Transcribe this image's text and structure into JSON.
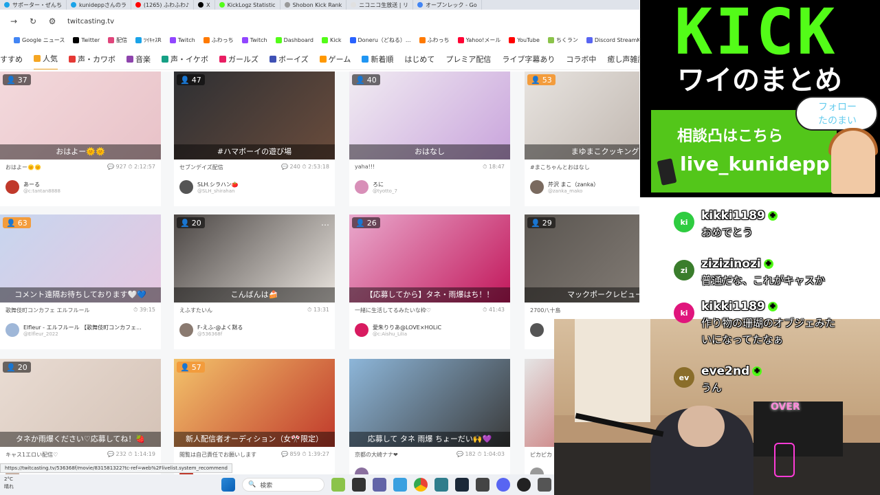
{
  "tabs": [
    {
      "label": "サポーター・ぜんち",
      "color": "#1aa3e8"
    },
    {
      "label": "kunideppさんのラ",
      "color": "#1aa3e8"
    },
    {
      "label": "(1265) ふわふわ♪",
      "color": "#ff0000"
    },
    {
      "label": "X",
      "color": "#000000"
    },
    {
      "label": "KickLogz Statistic",
      "color": "#53fc18"
    },
    {
      "label": "Shobon Kick Rank",
      "color": "#999999"
    },
    {
      "label": "ニコニコ生放送 | リ",
      "color": "#e0e0e0"
    },
    {
      "label": "オープンレック - Go",
      "color": "#4285f4"
    }
  ],
  "address": {
    "url": "twitcasting.tv"
  },
  "bookmarks": [
    {
      "label": "Google ニュース",
      "color": "#4285f4"
    },
    {
      "label": "Twitter",
      "color": "#000000"
    },
    {
      "label": "配信",
      "color": "#e0457b"
    },
    {
      "label": "ﾂｲｷｬｽR",
      "color": "#1aa3e8"
    },
    {
      "label": "Twitch",
      "color": "#9146ff"
    },
    {
      "label": "ふわっち",
      "color": "#ff7a00"
    },
    {
      "label": "Twitch",
      "color": "#9146ff"
    },
    {
      "label": "Dashboard",
      "color": "#53fc18"
    },
    {
      "label": "Kick",
      "color": "#53fc18"
    },
    {
      "label": "Doneru（どねる）...",
      "color": "#2962ff"
    },
    {
      "label": "ふわっち",
      "color": "#ff7a00"
    },
    {
      "label": "Yahoo!メール",
      "color": "#ff0033"
    },
    {
      "label": "YouTube",
      "color": "#ff0000"
    },
    {
      "label": "ちくラン",
      "color": "#8bc34a"
    },
    {
      "label": "Discord StreamKit O...",
      "color": "#5865f2"
    }
  ],
  "categories": [
    {
      "label": "すすめ",
      "color": "",
      "active": false
    },
    {
      "label": "人気",
      "color": "#f5a623",
      "active": true
    },
    {
      "label": "声・カワボ",
      "color": "#e53935",
      "active": false
    },
    {
      "label": "音楽",
      "color": "#8e44ad",
      "active": false
    },
    {
      "label": "声・イケボ",
      "color": "#16a085",
      "active": false
    },
    {
      "label": "ガールズ",
      "color": "#e91e63",
      "active": false
    },
    {
      "label": "ボーイズ",
      "color": "#3f51b5",
      "active": false
    },
    {
      "label": "ゲーム",
      "color": "#ff9800",
      "active": false
    },
    {
      "label": "新着順",
      "color": "#2196f3",
      "active": false
    },
    {
      "label": "はじめて",
      "color": "",
      "active": false
    },
    {
      "label": "プレミア配信",
      "color": "",
      "active": false
    },
    {
      "label": "ライブ字幕あり",
      "color": "",
      "active": false
    },
    {
      "label": "コラボ中",
      "color": "",
      "active": false
    },
    {
      "label": "癒し声雑談",
      "color": "",
      "active": false
    }
  ],
  "cards": [
    {
      "viewers": "37",
      "hot": false,
      "caption": "おはよー🌞🌞",
      "title": "おはよー🌞🌞",
      "stats": "💬 927  ⏱ 2:12:57",
      "user": "あーる",
      "uid": "@c:tantan8888",
      "thumb": "#f3d9dc",
      "thumb2": "#e8c2c8",
      "avatar": "#c0392b"
    },
    {
      "viewers": "47",
      "hot": false,
      "caption": "#ハマボーイの遊び場",
      "title": "セブンデイズ配信",
      "stats": "💬 240  ⏱ 2:53:18",
      "user": "SLH.シラハン🍅",
      "uid": "@SLH_shirahan",
      "thumb": "#2d2f33",
      "thumb2": "#6a4c3c",
      "avatar": "#555555"
    },
    {
      "viewers": "40",
      "hot": false,
      "caption": "おはなし",
      "title": "yaha!!!",
      "stats": "⏱ 18:47",
      "user": "ろに",
      "uid": "@tyotto_7",
      "thumb": "#f1ecf2",
      "thumb2": "#c9a4dc",
      "avatar": "#d88fb8"
    },
    {
      "viewers": "53",
      "hot": true,
      "caption": "まゆまこクッキング",
      "title": "#まこちゃんとおはなし",
      "stats": "",
      "user": "芹沢 まこ（zanka）",
      "uid": "@zanka_mako",
      "thumb": "#e8e4e0",
      "thumb2": "#b8aea6",
      "avatar": "#7a6a5f"
    },
    {
      "viewers": "63",
      "hot": true,
      "caption": "コメント遠隔お待ちしております🤍💙",
      "title": "歌舞伎町コンカフェ エルフルール",
      "stats": "⏱ 39:15",
      "user": "Elfleur - エルフルール 【歌舞伎町コンカフェ...",
      "uid": "@Elfleur_2022",
      "thumb": "#c7d6ef",
      "thumb2": "#e6c7e0",
      "avatar": "#9fb7d8"
    },
    {
      "viewers": "20",
      "hot": false,
      "caption": "こんばんは🍰",
      "title": "えふすたいん",
      "stats": "⏱ 13:31",
      "user": "F-えふ-@よく黙る",
      "uid": "@536368f",
      "thumb": "#4a4543",
      "thumb2": "#e9e4de",
      "avatar": "#8a7a70"
    },
    {
      "viewers": "26",
      "hot": false,
      "caption": "【応募してから】タネ・雨爆はち！！",
      "title": "一緒に生活してるみたいな枠♡",
      "stats": "⏱ 41:43",
      "user": "愛朱りりあ@LOVE×HOLiC",
      "uid": "@c:Aishu_Lilia",
      "thumb": "#e9a9cd",
      "thumb2": "#c2185b",
      "avatar": "#d81b60"
    },
    {
      "viewers": "29",
      "hot": false,
      "caption": "マックポークレビュー",
      "title": "2700八十島",
      "stats": "",
      "user": "",
      "uid": "",
      "thumb": "#5a5550",
      "thumb2": "#8a837c",
      "avatar": "#555555"
    },
    {
      "viewers": "20",
      "hot": false,
      "caption": "タネか雨爆ください♡応募してね！🍓",
      "title": "キャス1エロい配信♡",
      "stats": "💬 232  ⏱ 1:14:19",
      "user": "",
      "uid": "",
      "thumb": "#e9dcd3",
      "thumb2": "#d4c2b6",
      "avatar": "#c9b2a5"
    },
    {
      "viewers": "57",
      "hot": true,
      "caption": "新人配信者オーディション（女🎌限定）",
      "title": "閲覧は自己責任でお願いします",
      "stats": "💬 859  ⏱ 1:39:27",
      "user": "",
      "uid": "",
      "thumb": "#f3c36b",
      "thumb2": "#c0392b",
      "avatar": "#c0392b"
    },
    {
      "viewers": "",
      "hot": false,
      "caption": "応募して タネ 雨爆 ちょーだい🙌💜",
      "title": "京都の大崎ナナ❤",
      "stats": "💬 182  ⏱ 1:04:03",
      "user": "",
      "uid": "",
      "thumb": "#8db6d9",
      "thumb2": "#3a3a3a",
      "avatar": "#8a6f9e"
    },
    {
      "viewers": "",
      "hot": false,
      "caption": "",
      "title": "ピカピカ",
      "stats": "",
      "user": "",
      "uid": "",
      "thumb": "#e5e5e5",
      "thumb2": "#b83030",
      "avatar": "#999999"
    }
  ],
  "status_url": "https://twitcasting.tv/536368f/movie/831581322?tc-ref=web%2Flivelist.system_recommend",
  "taskbar": {
    "temp": "2°C",
    "weather": "晴れ",
    "search": "検索"
  },
  "kick": {
    "logo": "KICK",
    "subtitle": "ワイのまとめ",
    "soudan": "相談凸はこちら",
    "id": "live_kunidepp",
    "follow": "フォロー たのまい",
    "brand_color": "#53fc18"
  },
  "chat": [
    {
      "initials": "ki",
      "name": "kikki1189",
      "text": [
        "おめでとう"
      ],
      "color": "#2ecc40"
    },
    {
      "initials": "zi",
      "name": "zizizinozi",
      "text": [
        "普通だな、これがキャスか"
      ],
      "color": "#3a7d2c"
    },
    {
      "initials": "ki",
      "name": "kikki1189",
      "text": [
        "作り物の珊瑚のオブジェみた",
        "いになってたなぁ"
      ],
      "color": "#e0157c"
    },
    {
      "initials": "ev",
      "name": "eve2nd",
      "text": [
        "うん"
      ],
      "color": "#8a6d2a"
    }
  ],
  "webcam": {
    "sign": "OVER"
  }
}
